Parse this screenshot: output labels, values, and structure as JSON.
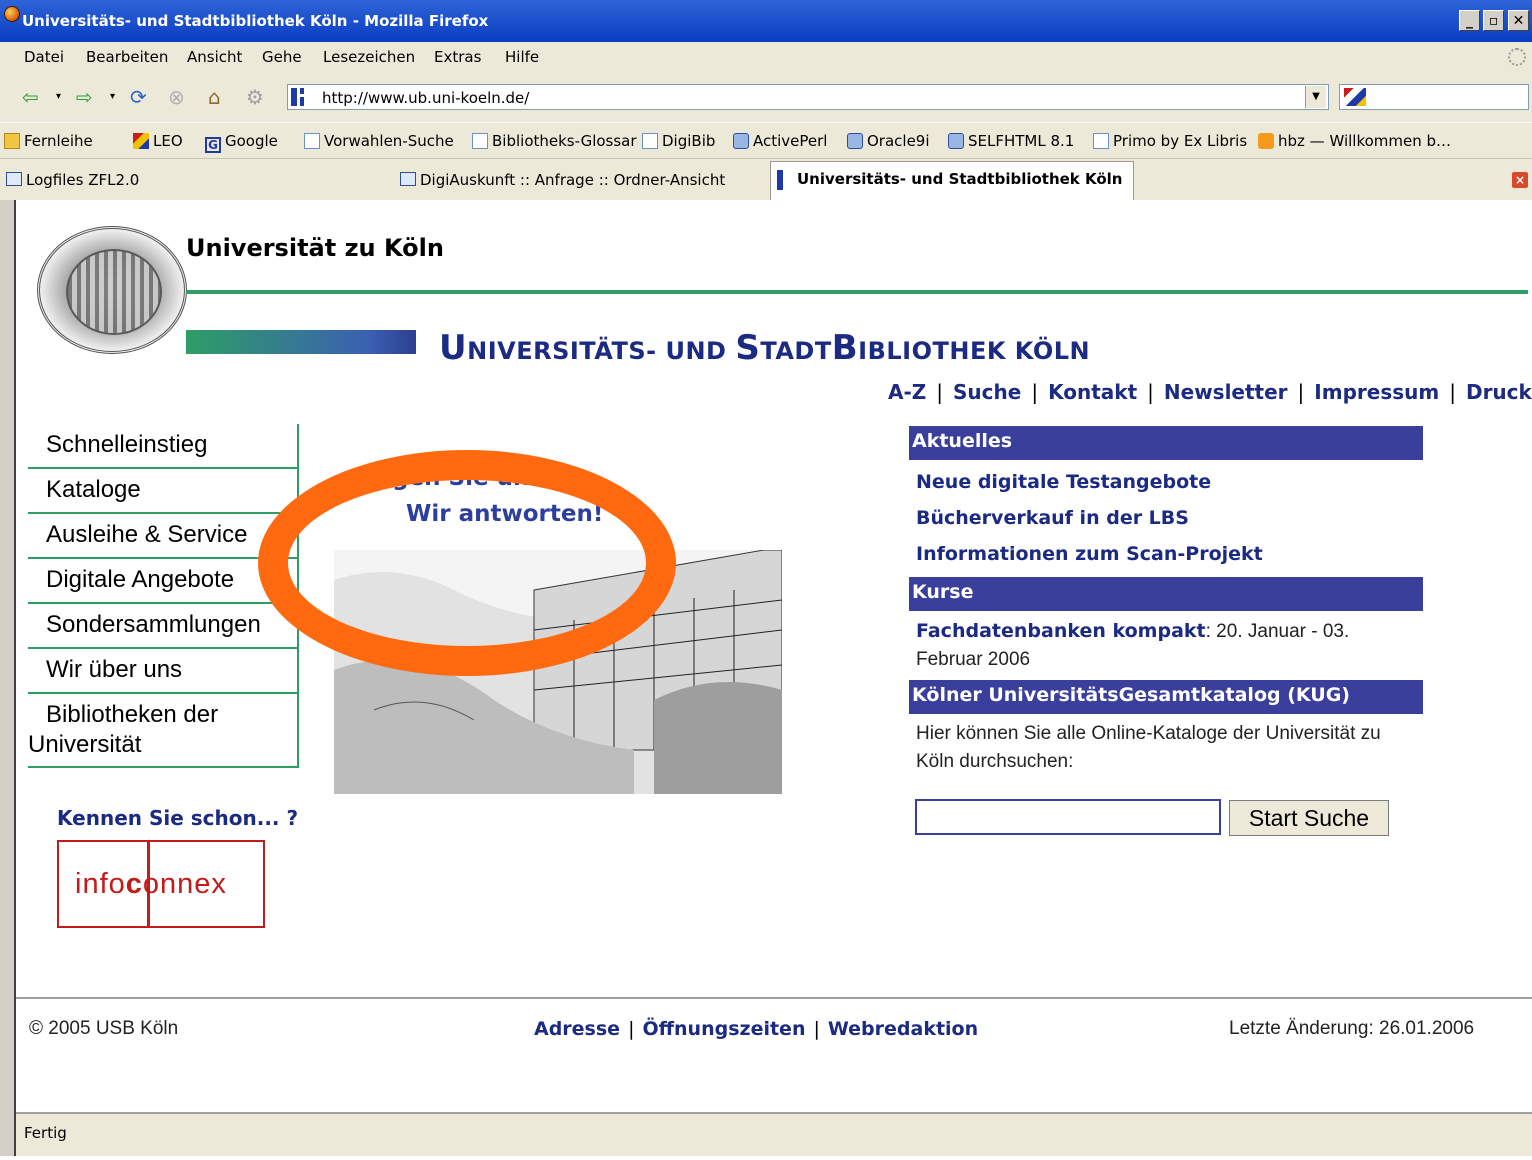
{
  "window": {
    "title": "Universitäts- und Stadtbibliothek Köln - Mozilla Firefox",
    "min": "_",
    "max": "▫",
    "close": "✕"
  },
  "menu": [
    "Datei",
    "Bearbeiten",
    "Ansicht",
    "Gehe",
    "Lesezeichen",
    "Extras",
    "Hilfe"
  ],
  "address": {
    "url": "http://www.ub.uni-koeln.de/"
  },
  "bookmarks": [
    {
      "label": "Fernleihe",
      "icon": "folder-icon"
    },
    {
      "label": "LEO",
      "icon": "leo-icon"
    },
    {
      "label": "Google",
      "icon": "google-icon"
    },
    {
      "label": "Vorwahlen-Suche",
      "icon": "bookmark-icon"
    },
    {
      "label": "Bibliotheks-Glossar",
      "icon": "bookmark-icon"
    },
    {
      "label": "DigiBib",
      "icon": "page-icon"
    },
    {
      "label": "ActivePerl",
      "icon": "disk-icon"
    },
    {
      "label": "Oracle9i",
      "icon": "disk-icon"
    },
    {
      "label": "SELFHTML 8.1",
      "icon": "disk-icon"
    },
    {
      "label": "Primo by Ex Libris",
      "icon": "page-icon"
    },
    {
      "label": "hbz — Willkommen b…",
      "icon": "rss-icon"
    }
  ],
  "tabs": [
    {
      "label": "Logfiles ZFL2.0",
      "active": false
    },
    {
      "label": "DigiAuskunft :: Anfrage :: Ordner-Ansicht",
      "active": false
    },
    {
      "label": "Universitäts- und Stadtbibliothek Köln",
      "active": true
    }
  ],
  "page": {
    "university": "Universität zu Köln",
    "library_title": {
      "part1_big": "U",
      "part1": "NIVERSITÄTS- UND ",
      "part2_big": "S",
      "part2": "TADT",
      "part3_big": "B",
      "part3": "IBLIOTHEK KÖLN"
    },
    "topnav": [
      "A-Z",
      "Suche",
      "Kontakt",
      "Newsletter",
      "Impressum",
      "Druck"
    ],
    "leftnav": [
      "Schnelleinstieg",
      "Kataloge",
      "Ausleihe & Service",
      "Digitale Angebote",
      "Sondersammlungen",
      "Wir über uns",
      "Bibliotheken der Universität"
    ],
    "kennen": "Kennen Sie schon... ?",
    "infoconnex": {
      "a": "info",
      "b": "c",
      "c": "onnex"
    },
    "fragen": [
      "Fragen Sie uns!",
      "Wir antworten!"
    ],
    "aktuelles": {
      "header": "Aktuelles",
      "links": [
        "Neue digitale Testangebote",
        "Bücherverkauf in der LBS",
        "Informationen zum Scan-Projekt"
      ]
    },
    "kurse": {
      "header": "Kurse",
      "link": "Fachdatenbanken kompakt",
      "text": ": 20. Januar - 03. Februar 2006"
    },
    "kug": {
      "header": "Kölner UniversitätsGesamtkatalog (KUG)",
      "text": "Hier können Sie alle Online-Kataloge der Universität zu Köln durchsuchen:",
      "input_value": "",
      "button": "Start Suche"
    },
    "footer": {
      "copyright": "© 2005 USB Köln",
      "links": [
        "Adresse",
        "Öffnungszeiten",
        "Webredaktion"
      ],
      "last_change": "Letzte Änderung: 26.01.2006"
    }
  },
  "status": "Fertig",
  "colors": {
    "accent_orange": "#ff6a10",
    "library_blue": "#1b2a83",
    "green": "#2e9e66",
    "header_blue": "#3b3f9c"
  }
}
